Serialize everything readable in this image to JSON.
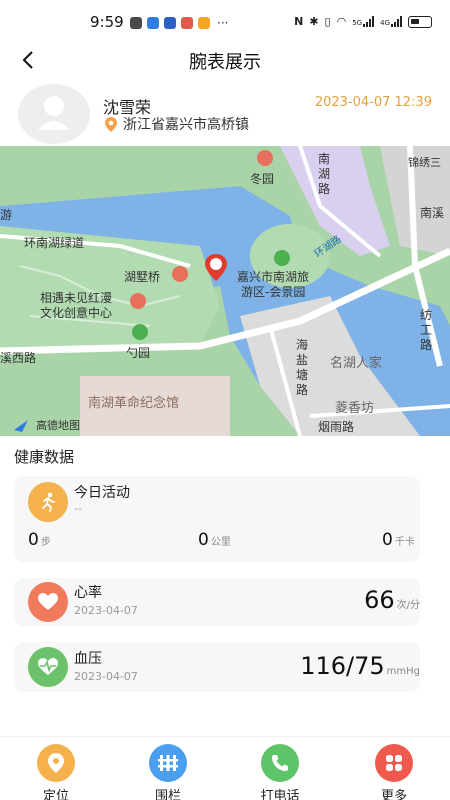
{
  "status_bar": {
    "time": "9:59",
    "dots": "···",
    "net_5g": "5G",
    "net_4g": "4G"
  },
  "header": {
    "title": "腕表展示"
  },
  "profile": {
    "name": "沈雪荣",
    "location": "浙江省嘉兴市高桥镇",
    "datetime": "2023-04-07 12:39",
    "date_color": "#e6a043"
  },
  "map": {
    "labels": {
      "huanhu": "环南湖绿道",
      "hushuqiao": "湖墅桥",
      "xiangyu_1": "相遇未见红漫",
      "xiangyu_2": "文化创意中心",
      "shaoyuan": "勺园",
      "dongyuan": "冬园",
      "nanhulu_1": "南",
      "nanhulu_2": "湖",
      "nanhulu_3": "路",
      "scenic_1": "嘉兴市南湖旅",
      "scenic_2": "游区-会景园",
      "nanhu_memorial": "南湖革命纪念馆",
      "haiyantang_1": "海",
      "haiyantang_2": "盐",
      "haiyantang_3": "塘",
      "haiyantang_4": "路",
      "minghu": "名湖人家",
      "lingxiang": "菱香坊",
      "yanyu": "烟雨路",
      "fanggong_1": "纺",
      "fanggong_2": "工",
      "fanggong_3": "路",
      "nanxi_left": "溪西路",
      "nanxi_right": "南溪",
      "you": "游",
      "jinhua": "锦绣三",
      "huanhu_road": "环湖路",
      "logo": "高德地图"
    }
  },
  "health": {
    "section_title": "健康数据",
    "activity": {
      "title": "今日活动",
      "subtitle": "--",
      "steps_value": "0",
      "steps_unit": "步",
      "distance_value": "0",
      "distance_unit": "公里",
      "calories_value": "0",
      "calories_unit": "千卡",
      "icon": "running-icon",
      "color": "#f5b14c"
    },
    "heart_rate": {
      "title": "心率",
      "date": "2023-04-07",
      "value": "66",
      "unit": "次/分",
      "icon": "heart-icon",
      "color": "#f07a5b"
    },
    "blood_pressure": {
      "title": "血压",
      "date": "2023-04-07",
      "value": "116/75",
      "unit": "mmHg",
      "icon": "heart-pulse-icon",
      "color": "#6cc26b"
    }
  },
  "nav": {
    "items": [
      {
        "label": "定位",
        "icon": "location-pin-icon",
        "color": "#f5b14c"
      },
      {
        "label": "围栏",
        "icon": "fence-icon",
        "color": "#4a9ff0"
      },
      {
        "label": "打电话",
        "icon": "phone-icon",
        "color": "#5ec46a"
      },
      {
        "label": "更多",
        "icon": "grid-more-icon",
        "color": "#f05a4e"
      }
    ]
  }
}
